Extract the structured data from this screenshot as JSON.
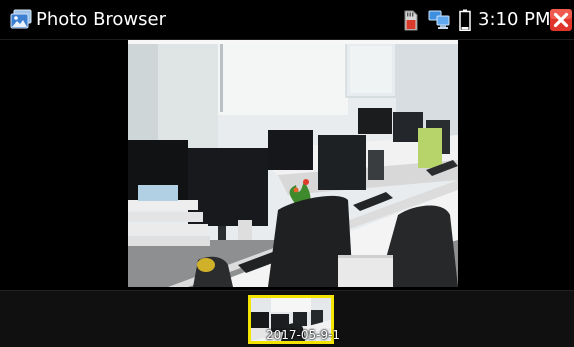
{
  "app": {
    "title": "Photo Browser",
    "icon": "photo-gallery-icon"
  },
  "status_bar": {
    "time": "3:10 PM",
    "icons": [
      "sd-card-icon",
      "network-icon",
      "battery-icon",
      "close-icon"
    ],
    "battery_level": 0.15
  },
  "viewer": {
    "current_photo": "office-desks-with-monitors-photo"
  },
  "thumbnails": {
    "items": [
      {
        "label": "2017-05-9-1",
        "selected": true
      }
    ]
  },
  "colors": {
    "background": "#000000",
    "selection": "#f3e500",
    "close": "#e53935",
    "text": "#ffffff"
  }
}
